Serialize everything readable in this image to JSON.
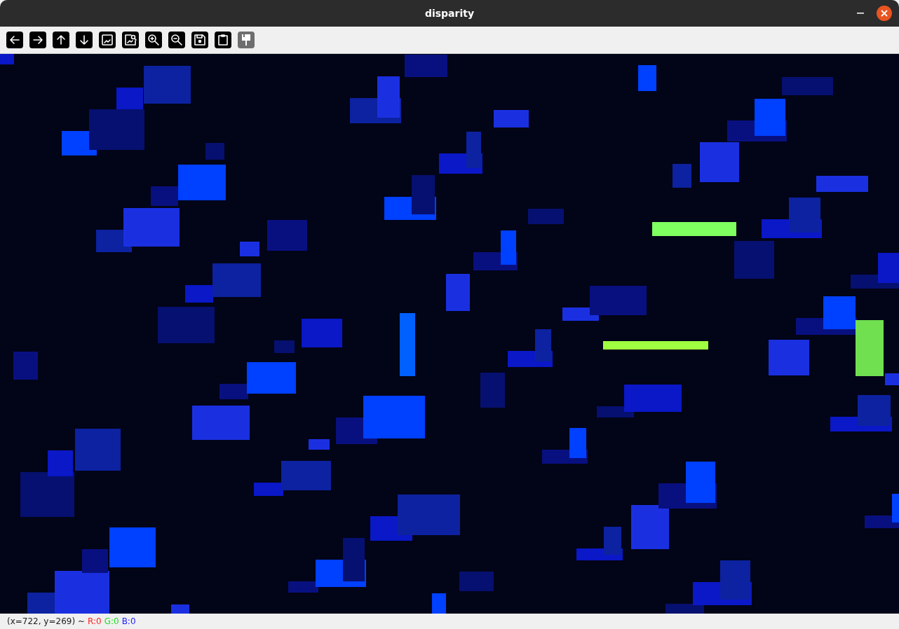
{
  "window": {
    "title": "disparity"
  },
  "toolbar": [
    {
      "kind": "left",
      "disabled": false
    },
    {
      "kind": "right",
      "disabled": false
    },
    {
      "kind": "up",
      "disabled": false
    },
    {
      "kind": "down",
      "disabled": false
    },
    {
      "kind": "image",
      "disabled": false
    },
    {
      "kind": "image-zoom",
      "disabled": false
    },
    {
      "kind": "zoom-in",
      "disabled": false
    },
    {
      "kind": "zoom-out",
      "disabled": false
    },
    {
      "kind": "save",
      "disabled": false
    },
    {
      "kind": "clipboard",
      "disabled": false
    },
    {
      "kind": "brush",
      "disabled": true
    }
  ],
  "status_bar": {
    "position": "(x=722, y=269) ~",
    "channels": [
      {
        "label": "R:0",
        "color": "#ff2020"
      },
      {
        "label": "G:0",
        "color": "#20e020"
      },
      {
        "label": "B:0",
        "color": "#2020ff"
      }
    ]
  }
}
